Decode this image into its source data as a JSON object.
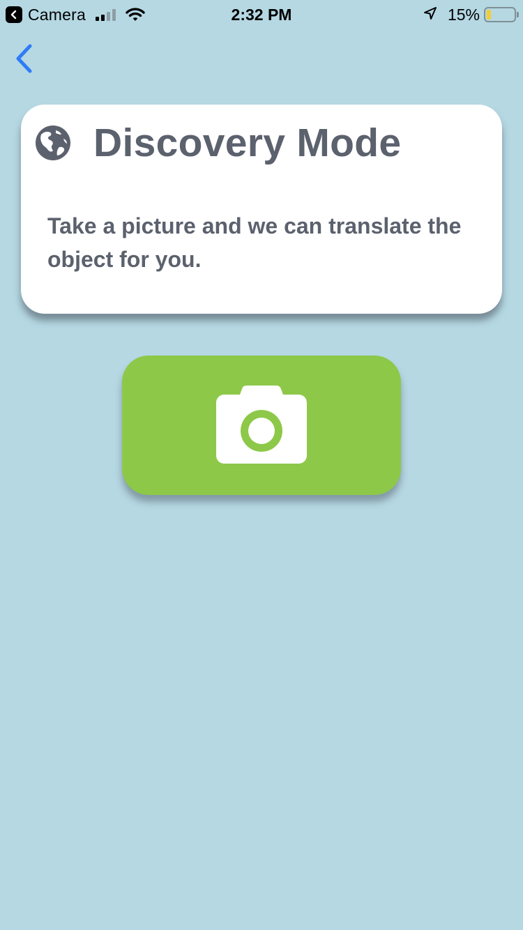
{
  "status_bar": {
    "back_app": "Camera",
    "time": "2:32 PM",
    "battery_percent": "15%",
    "battery_level": 0.15,
    "signal_bars_active": 2,
    "signal_bars_total": 4
  },
  "card": {
    "icon": "globe-icon",
    "title": "Discovery Mode",
    "description": "Take a picture and we can translate the object for you."
  },
  "action": {
    "icon": "camera-icon"
  },
  "colors": {
    "background": "#b5d8e3",
    "card": "#ffffff",
    "text": "#5b616d",
    "accent": "#8dc849",
    "back_arrow": "#2f7cf6",
    "battery_fill": "#f2cd33"
  }
}
